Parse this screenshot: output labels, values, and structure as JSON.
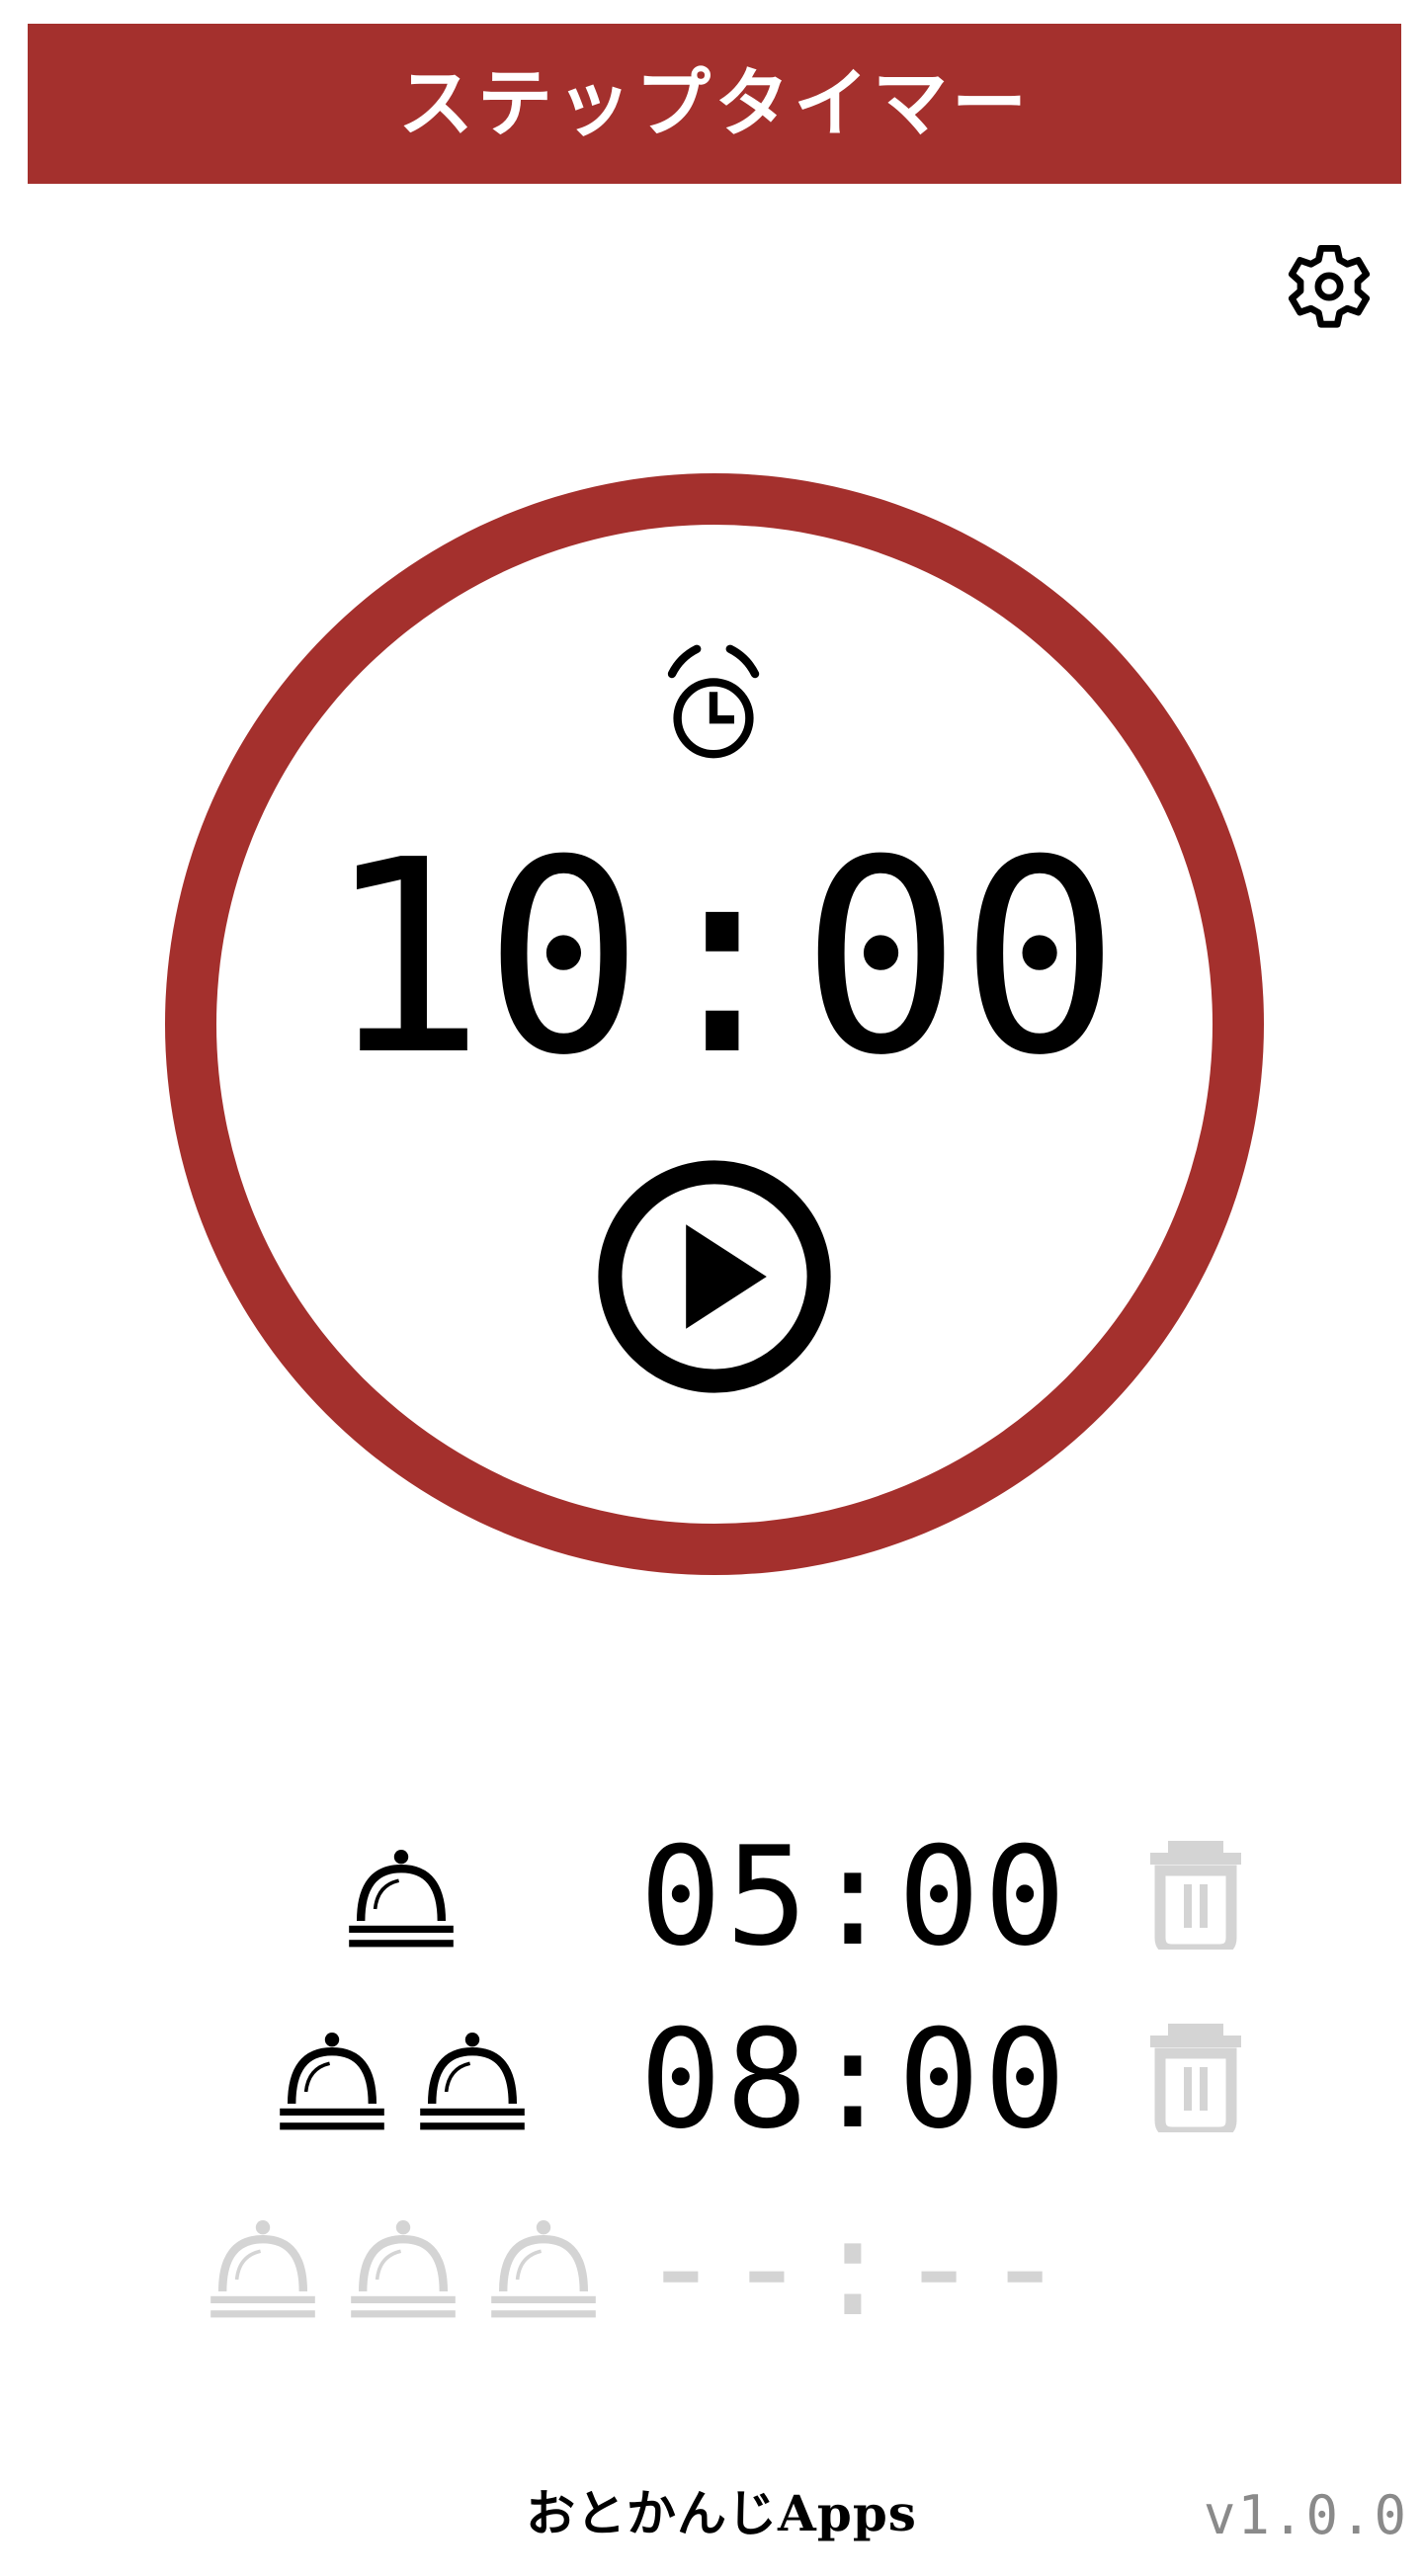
{
  "app": {
    "title": "ステップタイマー"
  },
  "icons": {
    "settings": "gear-icon",
    "alarm": "alarm-clock-icon",
    "play": "play-icon",
    "bell": "service-bell-icon",
    "delete": "trash-icon"
  },
  "timer": {
    "time": "10:00"
  },
  "steps": [
    {
      "bell_count": 1,
      "time": "05:00",
      "active": true
    },
    {
      "bell_count": 2,
      "time": "08:00",
      "active": true
    },
    {
      "bell_count": 3,
      "time": "--:--",
      "active": false
    }
  ],
  "footer": {
    "brand": "おとかんじApps",
    "version": "v1.0.0"
  },
  "colors": {
    "accent": "#a4302d",
    "text": "#000000",
    "inactive": "#d4d4d4",
    "version": "#8a8a8a"
  }
}
